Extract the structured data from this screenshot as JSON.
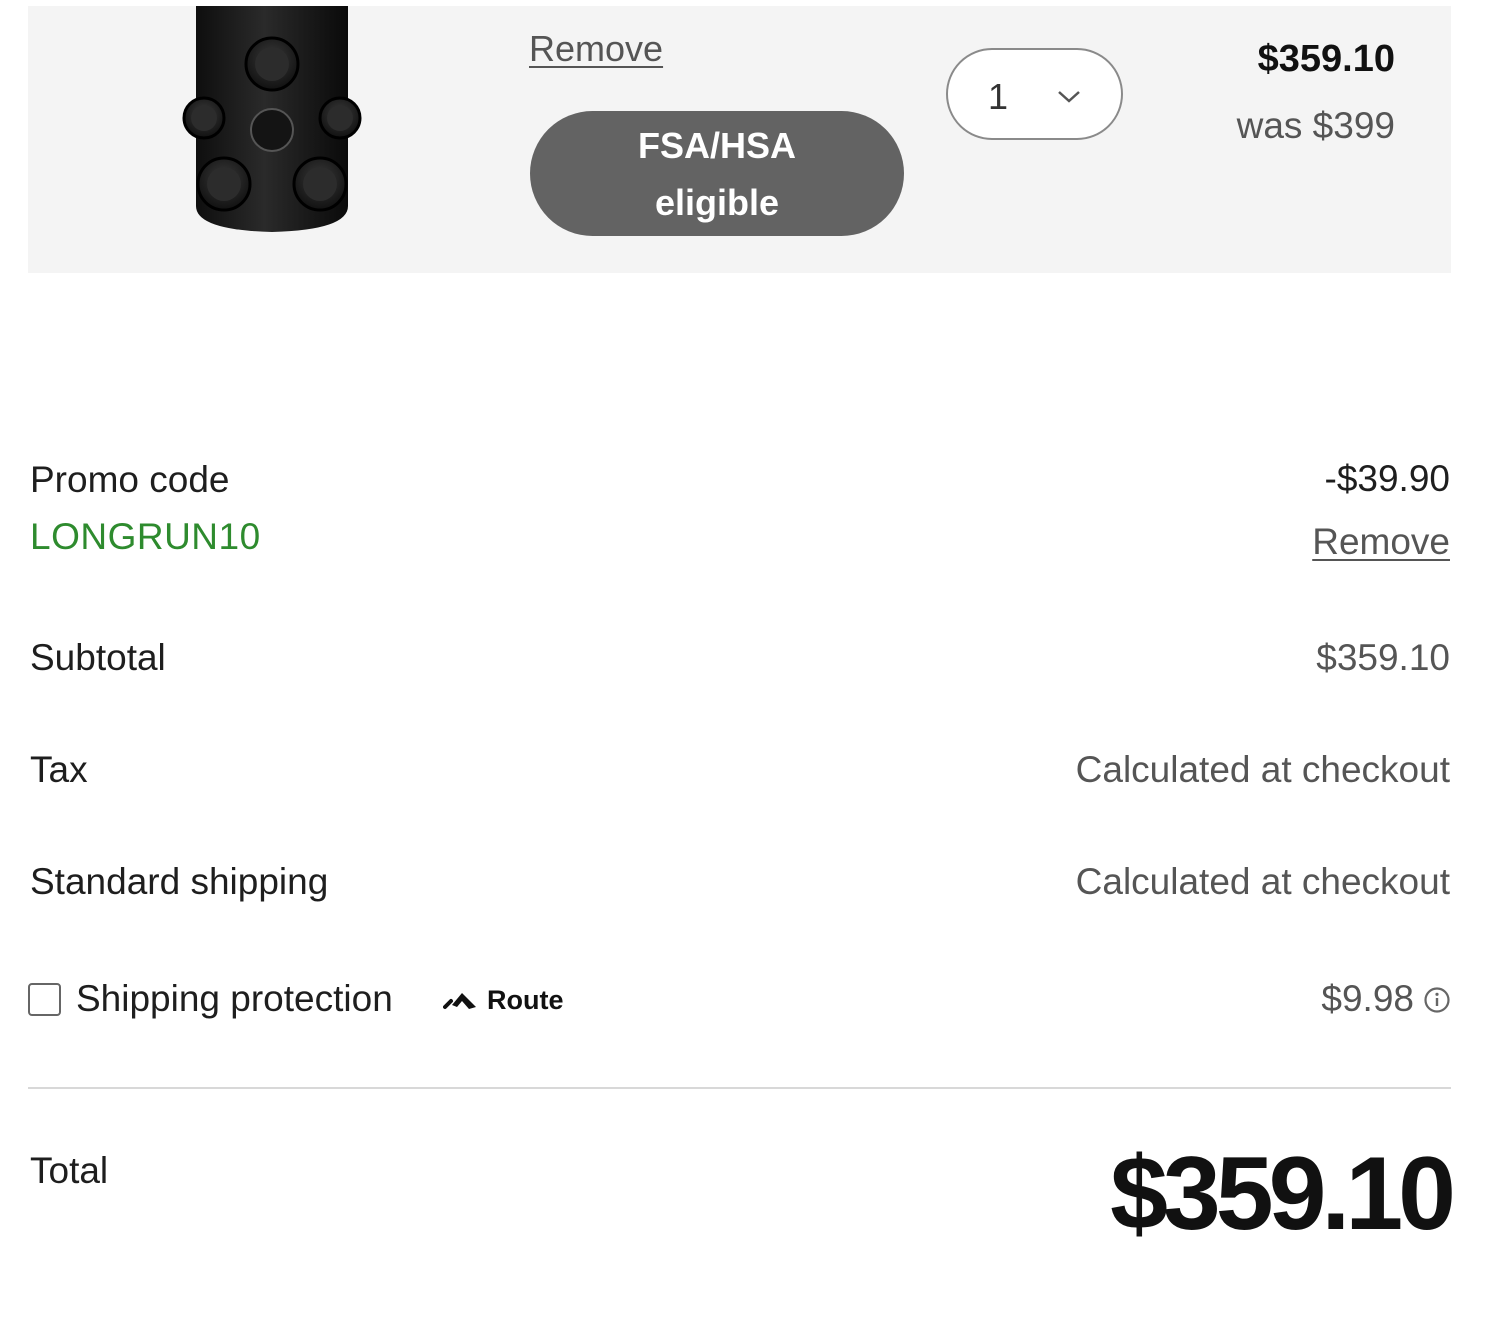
{
  "cart_item": {
    "image_alt": "black foam roller product image",
    "remove_label": "Remove",
    "badge_line1": "FSA/HSA",
    "badge_line2": "eligible",
    "quantity": "1",
    "price": "$359.10",
    "was_price": "was $399"
  },
  "summary": {
    "promo_label": "Promo code",
    "promo_code": "LONGRUN10",
    "promo_amount": "-$39.90",
    "promo_remove_label": "Remove",
    "subtotal_label": "Subtotal",
    "subtotal_value": "$359.10",
    "tax_label": "Tax",
    "tax_value": "Calculated at checkout",
    "shipping_label": "Standard shipping",
    "shipping_value": "Calculated at checkout",
    "protection_label": "Shipping protection",
    "protection_brand": "Route",
    "protection_price": "$9.98",
    "protection_checked": false,
    "total_label": "Total",
    "total_value": "$359.10"
  },
  "colors": {
    "card_bg": "#f4f4f4",
    "badge_bg": "#636363",
    "promo_green": "#2e8b2e",
    "divider": "#d8d8d8"
  },
  "icons": {
    "quantity_chevron": "chevron-down-icon",
    "info": "info-icon",
    "route_logo": "route-logo-icon"
  }
}
